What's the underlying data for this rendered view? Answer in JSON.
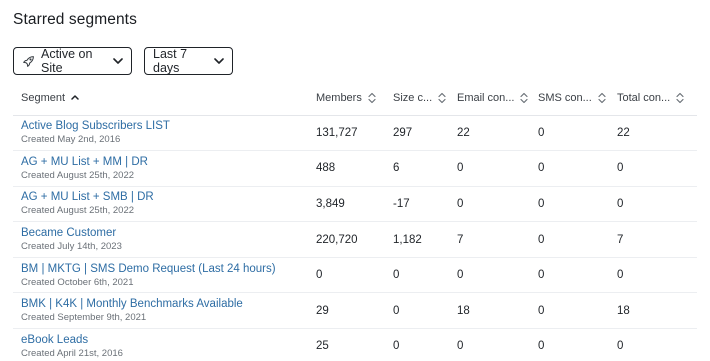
{
  "title": "Starred segments",
  "filters": {
    "site_filter": {
      "label": "Active on Site",
      "icon": "rocket-icon"
    },
    "date_filter": {
      "label": "Last 7 days"
    }
  },
  "columns": [
    {
      "label": "Segment",
      "sort": "ascending"
    },
    {
      "label": "Members",
      "sort": "none"
    },
    {
      "label": "Size c...",
      "sort": "none"
    },
    {
      "label": "Email con...",
      "sort": "none"
    },
    {
      "label": "SMS con...",
      "sort": "none"
    },
    {
      "label": "Total con...",
      "sort": "none"
    }
  ],
  "rows": [
    {
      "name": "Active Blog Subscribers LIST",
      "created": "Created May 2nd, 2016",
      "members": "131,727",
      "size_change": "297",
      "email": "22",
      "sms": "0",
      "total": "22"
    },
    {
      "name": "AG + MU List + MM | DR",
      "created": "Created August 25th, 2022",
      "members": "488",
      "size_change": "6",
      "email": "0",
      "sms": "0",
      "total": "0"
    },
    {
      "name": "AG + MU List + SMB | DR",
      "created": "Created August 25th, 2022",
      "members": "3,849",
      "size_change": "-17",
      "email": "0",
      "sms": "0",
      "total": "0"
    },
    {
      "name": "Became Customer",
      "created": "Created July 14th, 2023",
      "members": "220,720",
      "size_change": "1,182",
      "email": "7",
      "sms": "0",
      "total": "7"
    },
    {
      "name": "BM | MKTG | SMS Demo Request (Last 24 hours)",
      "created": "Created October 6th, 2021",
      "members": "0",
      "size_change": "0",
      "email": "0",
      "sms": "0",
      "total": "0"
    },
    {
      "name": "BMK | K4K | Monthly Benchmarks Available",
      "created": "Created September 9th, 2021",
      "members": "29",
      "size_change": "0",
      "email": "18",
      "sms": "0",
      "total": "18"
    },
    {
      "name": "eBook Leads",
      "created": "Created April 21st, 2016",
      "members": "25",
      "size_change": "0",
      "email": "0",
      "sms": "0",
      "total": "0"
    }
  ],
  "colors": {
    "link": "#2e6da4",
    "muted": "#6b7178",
    "border": "#e4e6ea"
  }
}
